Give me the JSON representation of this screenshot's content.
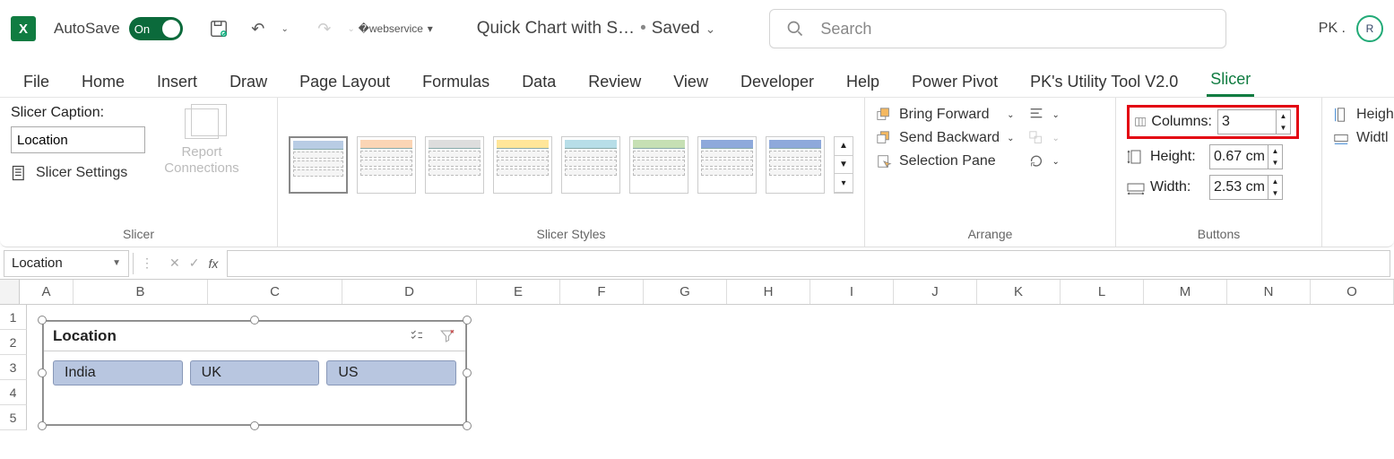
{
  "titlebar": {
    "autosave_label": "AutoSave",
    "autosave_state": "On",
    "doc_name": "Quick Chart with S…",
    "save_state": "Saved",
    "search_placeholder": "Search",
    "user_name": "PK .",
    "user_initials": "R"
  },
  "tabs": [
    "File",
    "Home",
    "Insert",
    "Draw",
    "Page Layout",
    "Formulas",
    "Data",
    "Review",
    "View",
    "Developer",
    "Help",
    "Power Pivot",
    "PK's Utility Tool V2.0",
    "Slicer"
  ],
  "active_tab": "Slicer",
  "ribbon": {
    "slicer": {
      "caption_label": "Slicer Caption:",
      "caption_value": "Location",
      "settings_label": "Slicer Settings",
      "report_conn": "Report\nConnections",
      "group_label": "Slicer"
    },
    "styles": {
      "group_label": "Slicer Styles"
    },
    "arrange": {
      "bring_forward": "Bring Forward",
      "send_backward": "Send Backward",
      "selection_pane": "Selection Pane",
      "group_label": "Arrange"
    },
    "buttons": {
      "columns_label": "Columns:",
      "columns_value": "3",
      "height_label": "Height:",
      "height_value": "0.67 cm",
      "width_label": "Width:",
      "width_value": "2.53 cm",
      "group_label": "Buttons"
    },
    "size": {
      "height_label": "Heigh",
      "width_label": "Widtl"
    }
  },
  "formula": {
    "name_box": "Location"
  },
  "columns": [
    "A",
    "B",
    "C",
    "D",
    "E",
    "F",
    "G",
    "H",
    "I",
    "J",
    "K",
    "L",
    "M",
    "N",
    "O"
  ],
  "rows": [
    "1",
    "2",
    "3",
    "4",
    "5"
  ],
  "slicer_object": {
    "title": "Location",
    "items": [
      "India",
      "UK",
      "US"
    ]
  }
}
